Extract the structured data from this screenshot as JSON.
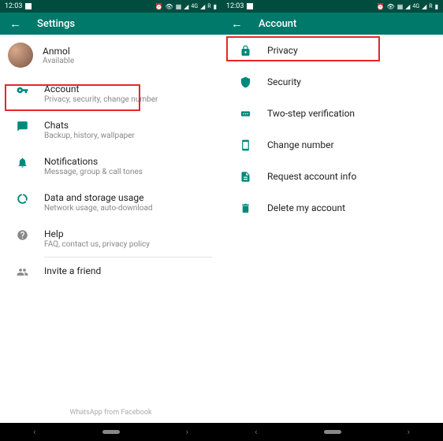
{
  "status": {
    "time": "12:03",
    "icons_text": "⏰ 👁 🖼 📶 ⁴⁶ 📶 ʀ 🔋"
  },
  "left": {
    "title": "Settings",
    "profile": {
      "name": "Anmol",
      "status": "Available"
    },
    "items": [
      {
        "title": "Account",
        "sub": "Privacy, security, change number"
      },
      {
        "title": "Chats",
        "sub": "Backup, history, wallpaper"
      },
      {
        "title": "Notifications",
        "sub": "Message, group & call tones"
      },
      {
        "title": "Data and storage usage",
        "sub": "Network usage, auto-download"
      },
      {
        "title": "Help",
        "sub": "FAQ, contact us, privacy policy"
      },
      {
        "title": "Invite a friend",
        "sub": ""
      }
    ],
    "footer": "WhatsApp from Facebook"
  },
  "right": {
    "title": "Account",
    "items": [
      {
        "title": "Privacy"
      },
      {
        "title": "Security"
      },
      {
        "title": "Two-step verification"
      },
      {
        "title": "Change number"
      },
      {
        "title": "Request account info"
      },
      {
        "title": "Delete my account"
      }
    ]
  }
}
